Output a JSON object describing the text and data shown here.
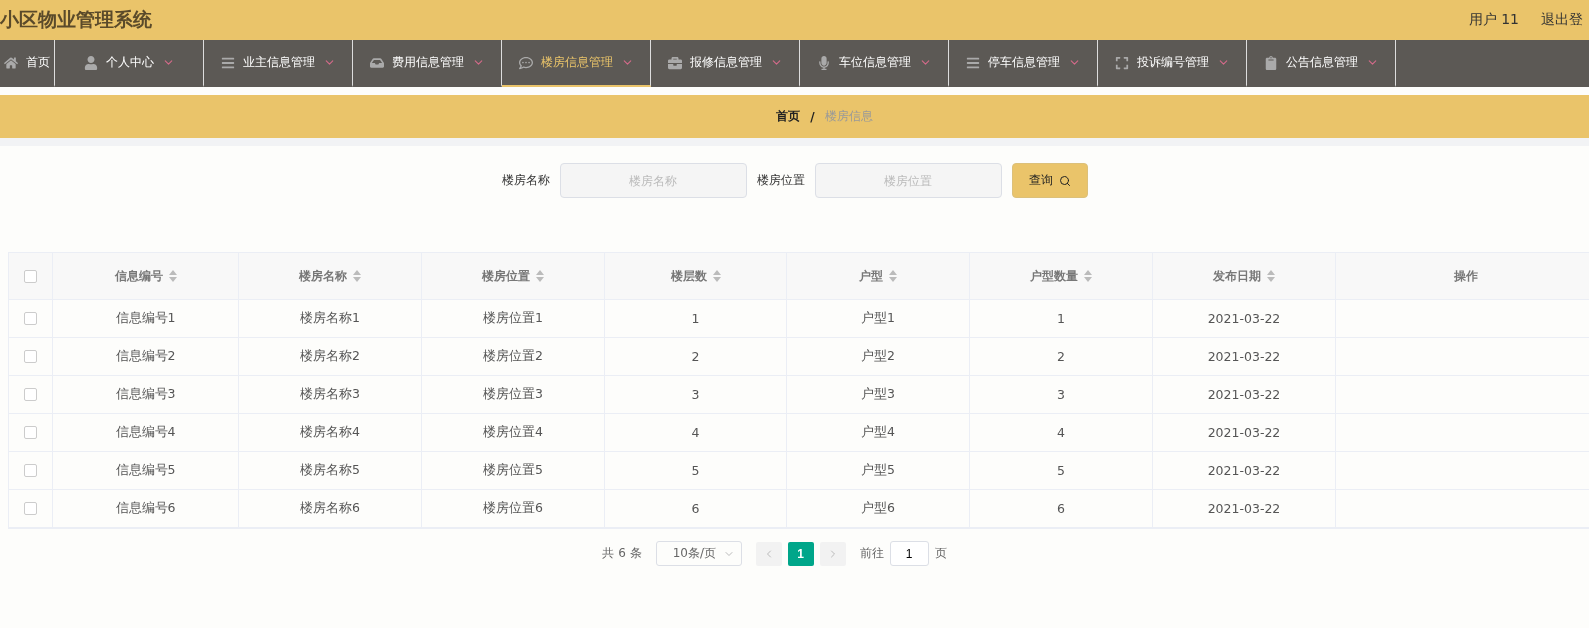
{
  "header": {
    "title": "小区物业管理系统",
    "user": "用户 11",
    "logout": "退出登"
  },
  "nav": [
    {
      "label": "首页",
      "selected": false
    },
    {
      "label": "个人中心",
      "selected": false
    },
    {
      "label": "业主信息管理",
      "selected": false
    },
    {
      "label": "费用信息管理",
      "selected": false
    },
    {
      "label": "楼房信息管理",
      "selected": true
    },
    {
      "label": "报修信息管理",
      "selected": false
    },
    {
      "label": "车位信息管理",
      "selected": false
    },
    {
      "label": "停车信息管理",
      "selected": false
    },
    {
      "label": "投诉编号管理",
      "selected": false
    },
    {
      "label": "公告信息管理",
      "selected": false
    }
  ],
  "breadcrumb": [
    "首页",
    "/",
    "楼房信息"
  ],
  "search": {
    "fields": [
      {
        "label": "楼房名称",
        "placeholder": "楼房名称"
      },
      {
        "label": "楼房位置",
        "placeholder": "楼房位置"
      }
    ],
    "button": "查询"
  },
  "table": {
    "all_checked": false,
    "columns": [
      "信息编号",
      "楼房名称",
      "楼房位置",
      "楼层数",
      "户型",
      "户型数量",
      "发布日期",
      "操作"
    ],
    "rows": [
      {
        "checked": false,
        "cells": [
          "信息编号1",
          "楼房名称1",
          "楼房位置1",
          "1",
          "户型1",
          "1",
          "2021-03-22"
        ]
      },
      {
        "checked": false,
        "cells": [
          "信息编号2",
          "楼房名称2",
          "楼房位置2",
          "2",
          "户型2",
          "2",
          "2021-03-22"
        ]
      },
      {
        "checked": false,
        "cells": [
          "信息编号3",
          "楼房名称3",
          "楼房位置3",
          "3",
          "户型3",
          "3",
          "2021-03-22"
        ]
      },
      {
        "checked": false,
        "cells": [
          "信息编号4",
          "楼房名称4",
          "楼房位置4",
          "4",
          "户型4",
          "4",
          "2021-03-22"
        ]
      },
      {
        "checked": false,
        "cells": [
          "信息编号5",
          "楼房名称5",
          "楼房位置5",
          "5",
          "户型5",
          "5",
          "2021-03-22"
        ]
      },
      {
        "checked": false,
        "cells": [
          "信息编号6",
          "楼房名称6",
          "楼房位置6",
          "6",
          "户型6",
          "6",
          "2021-03-22"
        ]
      }
    ]
  },
  "pagination": {
    "total": "共 6 条",
    "page_size": "10条/页",
    "pages": [
      {
        "label": "1",
        "selected": true
      }
    ],
    "goto_label": "前往",
    "goto_value": "1",
    "page_unit": "页"
  }
}
